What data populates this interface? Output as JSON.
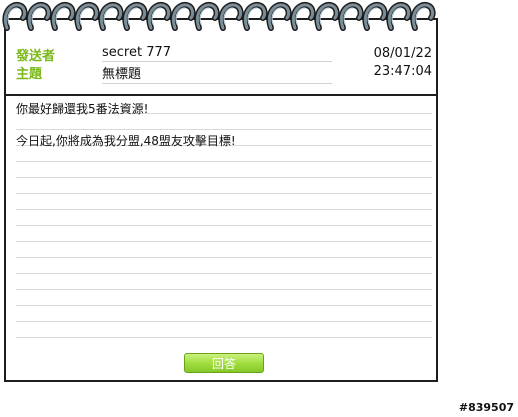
{
  "message": {
    "sender_label": "發送者",
    "sender": "secret 777",
    "subject_label": "主題",
    "subject": "無標題",
    "date": "08/01/22",
    "time": "23:47:04",
    "body_lines": [
      "你最好歸還我5番法資源!",
      "",
      "今日起,你將成為我分盟,48盟友攻擊目標!"
    ]
  },
  "actions": {
    "reply_label": "回答"
  },
  "footer": {
    "id_tag": "#839507"
  },
  "colors": {
    "label_green": "#7bb81a",
    "button_green": "#9fdc3c",
    "border": "#1e1e1e",
    "rule": "#d6dadd"
  },
  "icons": {
    "binding": "spiral-binding-icon"
  }
}
